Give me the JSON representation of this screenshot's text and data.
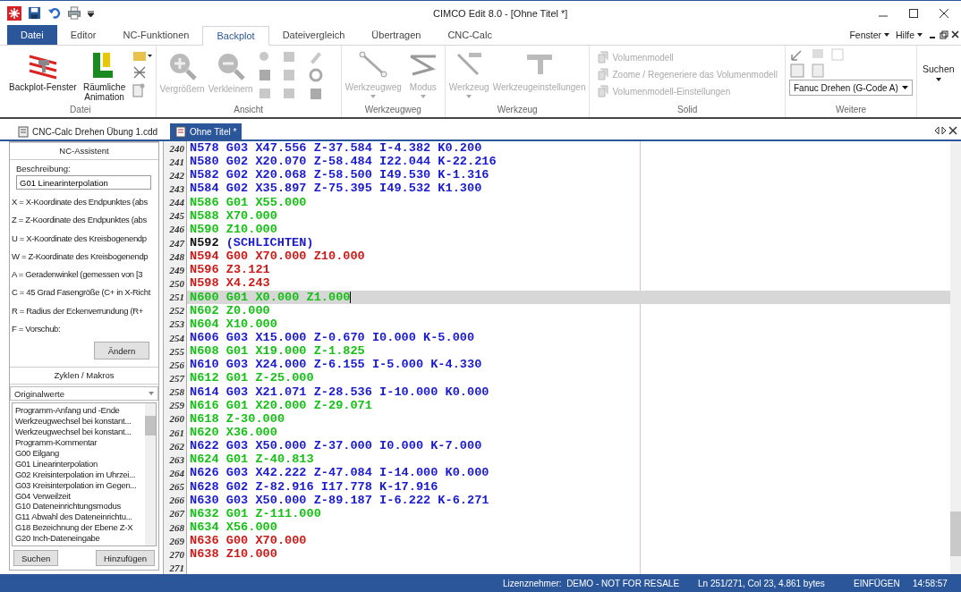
{
  "window": {
    "title": "CIMCO Edit 8.0 - [Ohne Titel *]"
  },
  "menu_tabs": [
    {
      "label": "Datei",
      "kind": "file",
      "selected": false
    },
    {
      "label": "Editor",
      "kind": "tab",
      "selected": false
    },
    {
      "label": "NC-Funktionen",
      "kind": "tab",
      "selected": false
    },
    {
      "label": "Backplot",
      "kind": "tab",
      "selected": true
    },
    {
      "label": "Dateivergleich",
      "kind": "tab",
      "selected": false
    },
    {
      "label": "Übertragen",
      "kind": "tab",
      "selected": false
    },
    {
      "label": "CNC-Calc",
      "kind": "tab",
      "selected": false
    }
  ],
  "menu_right": [
    "Fenster",
    "Hilfe"
  ],
  "ribbon": {
    "groups": [
      {
        "title": "Datei",
        "buttons": [
          {
            "label": "Backplot-Fenster",
            "disabled": false
          },
          {
            "label": "Räumliche Animation",
            "disabled": false
          }
        ]
      },
      {
        "title": "Ansicht",
        "buttons": [
          {
            "label": "Vergrößern",
            "disabled": true
          },
          {
            "label": "Verkleinern",
            "disabled": true
          }
        ]
      },
      {
        "title": "Werkzeugweg",
        "buttons": [
          {
            "label": "Werkzeugweg",
            "disabled": true
          },
          {
            "label": "Modus",
            "disabled": true
          }
        ]
      },
      {
        "title": "Werkzeug",
        "buttons": [
          {
            "label": "Werkzeug",
            "disabled": true
          },
          {
            "label": "Werkzeugeinstellungen",
            "disabled": true
          }
        ]
      }
    ],
    "solid": {
      "title": "Solid",
      "items": [
        "Volumenmodell",
        "Zoome / Regeneriere das Volumenmodell",
        "Volumenmodell-Einstellungen"
      ]
    },
    "weitere": {
      "title": "Weitere",
      "dropdown": "Fanuc Drehen (G-Code A)"
    },
    "search": "Suchen"
  },
  "doc_tabs": [
    {
      "label": "CNC-Calc Drehen Übung 1.cdd",
      "selected": false
    },
    {
      "label": "Ohne Titel *",
      "selected": true
    }
  ],
  "nc_assistant": {
    "title": "NC-Assistent",
    "description_label": "Beschreibung:",
    "description": "G01 Linearinterpolation",
    "params": [
      "X = X-Koordinate des Endpunktes (abs",
      "Z = Z-Koordinate des Endpunktes (abs",
      "U = X-Koordinate des Kreisbogenendp",
      "W = Z-Koordinate des Kreisbogenendp",
      "A = Geradenwinkel (gemessen von [3",
      "C = 45 Grad Fasengröße (C+ in X-Richt",
      "R = Radius der Eckenverrundung (R+",
      "F = Vorschub:"
    ],
    "button": "Ändern"
  },
  "cycles": {
    "title": "Zyklen / Makros",
    "dropdown": "Originalwerte",
    "items": [
      "Programm-Anfang und -Ende",
      "Werkzeugwechsel bei konstant...",
      "Werkzeugwechsel bei konstant...",
      "Programm-Kommentar",
      "G00 Eilgang",
      "G01 Linearinterpolation",
      "G02 Kreisinterpolation im Uhrzei...",
      "G03 Kreisinterpolation im Gegen...",
      "G04 Verweilzeit",
      "G10 Dateneinrichtungsmodus",
      "G11 Abwahl des Dateneinrichtu...",
      "G18 Bezeichnung der Ebene Z-X",
      "G20 Inch-Dateneingabe"
    ],
    "buttons": [
      "Suchen",
      "Hinzufügen"
    ]
  },
  "code_lines": [
    {
      "number": "240",
      "text": "N578 G03 X47.556 Z-37.584 I-4.382 K0.200",
      "kind": "arc",
      "selected": false
    },
    {
      "number": "241",
      "text": "N580 G02 X20.070 Z-58.484 I22.044 K-22.216",
      "kind": "arc",
      "selected": false
    },
    {
      "number": "242",
      "text": "N582 G02 X20.068 Z-58.500 I49.530 K-1.316",
      "kind": "arc",
      "selected": false
    },
    {
      "number": "243",
      "text": "N584 G02 X35.897 Z-75.395 I49.532 K1.300",
      "kind": "arc",
      "selected": false
    },
    {
      "number": "244",
      "text": "N586 G01 X55.000",
      "kind": "linear",
      "selected": false
    },
    {
      "number": "245",
      "text": "N588 X70.000",
      "kind": "linear",
      "selected": false
    },
    {
      "number": "246",
      "text": "N590 Z10.000",
      "kind": "linear",
      "selected": false
    },
    {
      "number": "247",
      "text": "N592",
      "comment": "(SCHLICHTEN)",
      "kind": "comment",
      "selected": false
    },
    {
      "number": "248",
      "text": "N594 G00 X70.000 Z10.000",
      "kind": "rapid",
      "selected": false
    },
    {
      "number": "249",
      "text": "N596 Z3.121",
      "kind": "rapid",
      "selected": false
    },
    {
      "number": "250",
      "text": "N598 X4.243",
      "kind": "rapid",
      "selected": false
    },
    {
      "number": "251",
      "text": "N600 G01 X0.000 Z1.000",
      "kind": "linear",
      "selected": true
    },
    {
      "number": "252",
      "text": "N602 Z0.000",
      "kind": "linear",
      "selected": false
    },
    {
      "number": "253",
      "text": "N604 X10.000",
      "kind": "linear",
      "selected": false
    },
    {
      "number": "254",
      "text": "N606 G03 X15.000 Z-0.670 I0.000 K-5.000",
      "kind": "arc",
      "selected": false
    },
    {
      "number": "255",
      "text": "N608 G01 X19.000 Z-1.825",
      "kind": "linear",
      "selected": false
    },
    {
      "number": "256",
      "text": "N610 G03 X24.000 Z-6.155 I-5.000 K-4.330",
      "kind": "arc",
      "selected": false
    },
    {
      "number": "257",
      "text": "N612 G01 Z-25.000",
      "kind": "linear",
      "selected": false
    },
    {
      "number": "258",
      "text": "N614 G03 X21.071 Z-28.536 I-10.000 K0.000",
      "kind": "arc",
      "selected": false
    },
    {
      "number": "259",
      "text": "N616 G01 X20.000 Z-29.071",
      "kind": "linear",
      "selected": false
    },
    {
      "number": "260",
      "text": "N618 Z-30.000",
      "kind": "linear",
      "selected": false
    },
    {
      "number": "261",
      "text": "N620 X36.000",
      "kind": "linear",
      "selected": false
    },
    {
      "number": "262",
      "text": "N622 G03 X50.000 Z-37.000 I0.000 K-7.000",
      "kind": "arc",
      "selected": false
    },
    {
      "number": "263",
      "text": "N624 G01 Z-40.813",
      "kind": "linear",
      "selected": false
    },
    {
      "number": "264",
      "text": "N626 G03 X42.222 Z-47.084 I-14.000 K0.000",
      "kind": "arc",
      "selected": false
    },
    {
      "number": "265",
      "text": "N628 G02 Z-82.916 I17.778 K-17.916",
      "kind": "arc",
      "selected": false
    },
    {
      "number": "266",
      "text": "N630 G03 X50.000 Z-89.187 I-6.222 K-6.271",
      "kind": "arc",
      "selected": false
    },
    {
      "number": "267",
      "text": "N632 G01 Z-111.000",
      "kind": "linear",
      "selected": false
    },
    {
      "number": "268",
      "text": "N634 X56.000",
      "kind": "linear",
      "selected": false
    },
    {
      "number": "269",
      "text": "N636 G00 X70.000",
      "kind": "rapid",
      "selected": false
    },
    {
      "number": "270",
      "text": "N638 Z10.000",
      "kind": "rapid",
      "selected": false
    },
    {
      "number": "271",
      "selected": false
    }
  ],
  "status_bar": {
    "license": "Lizenznehmer:  DEMO - NOT FOR RESALE",
    "position": "Ln 251/271, Col 23, 4.861 bytes",
    "mode": "EINFÜGEN",
    "time": "14:58:57"
  }
}
